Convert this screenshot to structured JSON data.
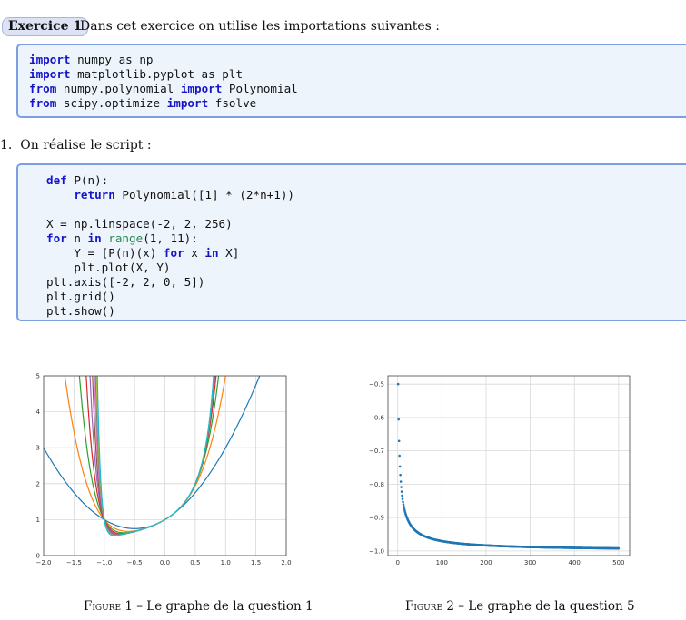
{
  "exercise": {
    "badge": "Exercice 1",
    "intro": "Dans cet exercice on utilise les importations suivantes :"
  },
  "code_imports": [
    [
      {
        "t": "import",
        "k": "kw"
      },
      {
        "t": " numpy as np"
      }
    ],
    [
      {
        "t": "import",
        "k": "kw"
      },
      {
        "t": " matplotlib.pyplot as plt"
      }
    ],
    [
      {
        "t": "from",
        "k": "kw"
      },
      {
        "t": " numpy.polynomial "
      },
      {
        "t": "import",
        "k": "kw"
      },
      {
        "t": " Polynomial"
      }
    ],
    [
      {
        "t": "from",
        "k": "kw"
      },
      {
        "t": " scipy.optimize "
      },
      {
        "t": "import",
        "k": "kw"
      },
      {
        "t": " fsolve"
      }
    ]
  ],
  "question1": {
    "number": "1.",
    "text": "On réalise le script :"
  },
  "code_script": [
    [
      {
        "t": "def",
        "k": "kw"
      },
      {
        "t": " P(n):"
      }
    ],
    [
      {
        "t": "    "
      },
      {
        "t": "return",
        "k": "kw"
      },
      {
        "t": " Polynomial([1] * (2*n+1))"
      }
    ],
    [
      {
        "t": ""
      }
    ],
    [
      {
        "t": "X = np.linspace(-2, 2, 256)"
      }
    ],
    [
      {
        "t": "for",
        "k": "kw"
      },
      {
        "t": " n "
      },
      {
        "t": "in",
        "k": "kw"
      },
      {
        "t": " "
      },
      {
        "t": "range",
        "k": "bi"
      },
      {
        "t": "(1, 11):"
      }
    ],
    [
      {
        "t": "    Y = [P(n)(x) "
      },
      {
        "t": "for",
        "k": "kw"
      },
      {
        "t": " x "
      },
      {
        "t": "in",
        "k": "kw"
      },
      {
        "t": " X]"
      }
    ],
    [
      {
        "t": "    plt.plot(X, Y)"
      }
    ],
    [
      {
        "t": "plt.axis([-2, 2, 0, 5])"
      }
    ],
    [
      {
        "t": "plt.grid()"
      }
    ],
    [
      {
        "t": "plt.show()"
      }
    ]
  ],
  "figures": [
    {
      "label": "Figure 1",
      "caption": " – Le graphe de la question 1"
    },
    {
      "label": "Figure 2",
      "caption": " – Le graphe de la question 5"
    }
  ],
  "chart_data": [
    {
      "type": "line",
      "series_definition": "P(n)(x) = 1 + x + ... + x^(2n)",
      "n_values": [
        1,
        2,
        3,
        4,
        5,
        6,
        7,
        8,
        9,
        10
      ],
      "xlim": [
        -2,
        2
      ],
      "ylim": [
        0,
        5
      ],
      "xticks": [
        "−2.0",
        "−1.5",
        "−1.0",
        "−0.5",
        "0.0",
        "0.5",
        "1.0",
        "1.5",
        "2.0"
      ],
      "yticks": [
        "0",
        "1",
        "2",
        "3",
        "4",
        "5"
      ],
      "grid": true,
      "colors": [
        "#1f77b4",
        "#ff7f0e",
        "#2ca02c",
        "#d62728",
        "#9467bd",
        "#8c564b",
        "#e377c2",
        "#7f7f7f",
        "#bcbd22",
        "#17becf"
      ]
    },
    {
      "type": "scatter",
      "x_range": [
        1,
        500
      ],
      "series_definition": "minimum point of P(n), n = 1..500",
      "sample_points": [
        [
          1,
          -0.5
        ],
        [
          2,
          -0.606
        ],
        [
          3,
          -0.67
        ],
        [
          4,
          -0.715
        ],
        [
          10,
          -0.84
        ],
        [
          50,
          -0.955
        ],
        [
          100,
          -0.972
        ],
        [
          200,
          -0.985
        ],
        [
          300,
          -0.989
        ],
        [
          500,
          -0.992
        ]
      ],
      "xlim": [
        -22,
        525
      ],
      "ylim": [
        -1.014,
        -0.475
      ],
      "xticks": [
        "0",
        "100",
        "200",
        "300",
        "400",
        "500"
      ],
      "yticks": [
        "−1.0",
        "−0.9",
        "−0.8",
        "−0.7",
        "−0.6",
        "−0.5"
      ],
      "grid": true,
      "color": "#1f77b4"
    }
  ]
}
